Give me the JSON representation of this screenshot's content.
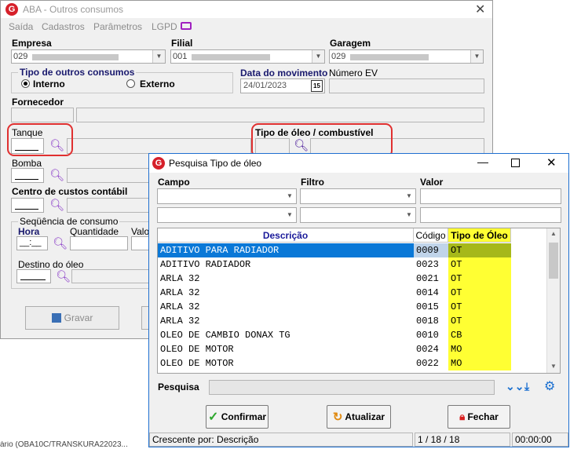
{
  "main": {
    "title": "ABA - Outros consumos",
    "menu": [
      "Saída",
      "Cadastros",
      "Parâmetros",
      "LGPD"
    ],
    "empresa": {
      "label": "Empresa",
      "value": "029"
    },
    "filial": {
      "label": "Filial",
      "value": "001"
    },
    "garagem": {
      "label": "Garagem",
      "value": "029"
    },
    "tipo_outros": {
      "label": "Tipo de outros consumos",
      "interno": "Interno",
      "externo": "Externo",
      "selected": "Interno"
    },
    "data_movimento": {
      "label": "Data do movimento",
      "value": "24/01/2023",
      "cal": "15"
    },
    "numero_ev": {
      "label": "Número EV"
    },
    "fornecedor": {
      "label": "Fornecedor"
    },
    "tanque": {
      "label": "Tanque"
    },
    "tipo_oleo": {
      "label": "Tipo de óleo / combustível"
    },
    "bomba": {
      "label": "Bomba"
    },
    "centro_custos": {
      "label": "Centro de custos contábil"
    },
    "sequencia": {
      "label": "Seqüência de consumo",
      "hora": "Hora",
      "hora_value": "__:__",
      "quantidade": "Quantidade",
      "valor": "Valor"
    },
    "destino": {
      "label": "Destino do óleo"
    },
    "gravar": "Gravar",
    "status_fragment": "ário (OBA10C/TRANSKURA22023..."
  },
  "dialog": {
    "title": "Pesquisa Tipo de óleo",
    "campo_label": "Campo",
    "filtro_label": "Filtro",
    "valor_label": "Valor",
    "columns": [
      "Descrição",
      "Código",
      "Tipo de Óleo"
    ],
    "rows": [
      {
        "descricao": "ADITIVO PARA RADIADOR",
        "codigo": "0009",
        "tipo": "OT"
      },
      {
        "descricao": "ADITIVO RADIADOR",
        "codigo": "0023",
        "tipo": "OT"
      },
      {
        "descricao": "ARLA 32",
        "codigo": "0021",
        "tipo": "OT"
      },
      {
        "descricao": "ARLA 32",
        "codigo": "0014",
        "tipo": "OT"
      },
      {
        "descricao": "ARLA 32",
        "codigo": "0015",
        "tipo": "OT"
      },
      {
        "descricao": "ARLA 32",
        "codigo": "0018",
        "tipo": "OT"
      },
      {
        "descricao": "OLEO DE CAMBIO DONAX TG",
        "codigo": "0010",
        "tipo": "CB"
      },
      {
        "descricao": "OLEO DE MOTOR",
        "codigo": "0024",
        "tipo": "MO"
      },
      {
        "descricao": "OLEO DE MOTOR",
        "codigo": "0022",
        "tipo": "MO"
      }
    ],
    "selected_row": 0,
    "pesquisa_label": "Pesquisa",
    "confirmar": "Confirmar",
    "atualizar": "Atualizar",
    "fechar": "Fechar",
    "status": {
      "sort": "Crescente por: Descrição",
      "pos": "1 / 18 / 18",
      "time": "00:00:00"
    }
  },
  "colors": {
    "selection": "#0a78d7",
    "yellow": "#ffff33",
    "highlight_red": "#e03030",
    "accent_purple": "#8a3cc8"
  }
}
